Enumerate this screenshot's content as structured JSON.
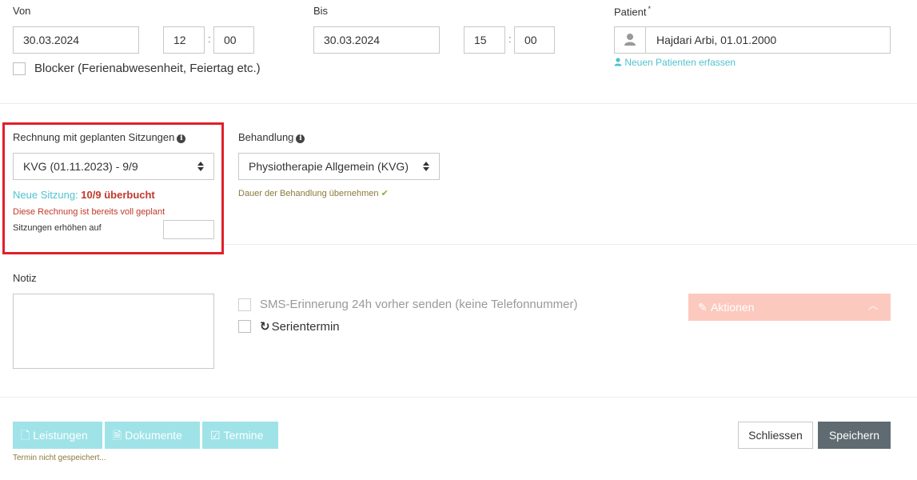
{
  "von": {
    "label": "Von",
    "date": "30.03.2024",
    "hour": "12",
    "minute": "00",
    "time_sep": ":"
  },
  "bis": {
    "label": "Bis",
    "date": "30.03.2024",
    "hour": "15",
    "minute": "00",
    "time_sep": ":"
  },
  "blocker": {
    "label": "Blocker (Ferienabwesenheit, Feiertag etc.)",
    "checked": false
  },
  "patient": {
    "label": "Patient",
    "required_mark": "*",
    "value": "Hajdari Arbi, 01.01.2000",
    "new_patient_link": "Neuen Patienten erfassen"
  },
  "rechnung": {
    "label": "Rechnung mit geplanten Sitzungen",
    "selected": "KVG (01.11.2023) - 9/9",
    "neue_sitzung_label": "Neue Sitzung:",
    "neue_sitzung_value": "10/9 überbucht",
    "warning": "Diese Rechnung ist bereits voll geplant",
    "increase_label": "Sitzungen erhöhen auf",
    "increase_value": ""
  },
  "behandlung": {
    "label": "Behandlung",
    "selected": "Physiotherapie Allgemein (KVG)",
    "dauer_text": "Dauer der Behandlung übernehmen"
  },
  "notiz": {
    "label": "Notiz",
    "value": ""
  },
  "options": {
    "sms_label": "SMS-Erinnerung 24h vorher senden (keine Telefonnummer)",
    "serien_label": "Serientermin"
  },
  "aktionen": {
    "label": "Aktionen"
  },
  "footer": {
    "leistungen": "Leistungen",
    "dokumente": "Dokumente",
    "termine": "Termine",
    "status": "Termin nicht gespeichert...",
    "schliessen": "Schliessen",
    "speichern": "Speichern"
  },
  "colors": {
    "teal": "#4fc3cf",
    "teal_light": "#9fe3e8",
    "red_highlight": "#e0202a",
    "red_text": "#c0392b",
    "olive": "#8a7a3a",
    "green_check": "#7cb342",
    "aktionen_bg": "#fcc9bf",
    "save_bg": "#5f6b70"
  }
}
